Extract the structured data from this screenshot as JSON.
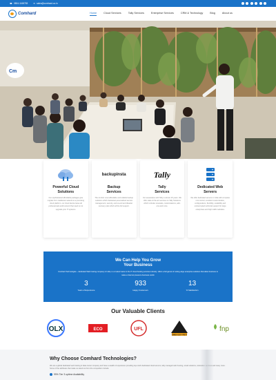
{
  "topbar": {
    "phone": "0804-1168783",
    "email": "sales@comhard.co.in",
    "socials": [
      "facebook-icon",
      "twitter-icon",
      "linkedin-icon",
      "instagram-icon",
      "youtube-icon",
      "whatsapp-icon"
    ]
  },
  "brand": {
    "logo_text": "Comhard"
  },
  "nav": {
    "items": [
      "Home",
      "Cloud Services",
      "Tally Services",
      "Enterprise Services",
      "CRM & Technology",
      "Blog",
      "About us"
    ],
    "active": "Home"
  },
  "cards": [
    {
      "logo": "cloud-icon",
      "title": "Powerful Cloud\nSolutions",
      "desc": "Our sophisticated affordable packages give migrate from traditional network to a promising cloud platform. our cloud device leave all professionals world around that need to not upgrade your IT systems."
    },
    {
      "logo": "backupinsta",
      "title": "Backup\nServices",
      "desc": "The comfort most affordable and reliable backup solutions which dedicated personalized service management, security, end-to-end and disaster recovery plan which all the full support."
    },
    {
      "logo": "Tally",
      "title": "Tally\nServices",
      "desc": "Our association with Tally is almost 15 years. We offer state-of-the-art services on Tally Solutions which includes renewals, customisations, add-ons and more."
    },
    {
      "logo": "server-icon",
      "title": "Dedicated Web\nServers",
      "desc": "We offer dedicated servers in India with complete root control, excellent customization, configurations, flexibility, scalability and uninterrupted technical support for large enterprises and high traffic websites."
    }
  ],
  "stats": {
    "title_line1": "We Can Help You Grow",
    "title_line2": "Your Business",
    "desc": "Comhard Technologies – dedicated Web hosting company in India, is a trusted name in the IT cloud hosting services industry. offers a full gamut of cutting edge enterprise solutions that allow business to make a Internet presence business world.",
    "items": [
      {
        "value": "3",
        "label": "Years of Experience"
      },
      {
        "value": "933",
        "label": "Happy Customers"
      },
      {
        "value": "13",
        "label": "% Satisfaction"
      }
    ]
  },
  "clients": {
    "title": "Our Valuable Clients",
    "logos": [
      "OLX",
      "ECO",
      "UFL",
      "EMBASSY REIT",
      "fnp"
    ]
  },
  "why": {
    "title": "Why Choose Comhard Technologies?",
    "desc": "We are a global dedicated web hosting & data center company and have a wealth of experience providing top-notch dedicated cloud servers, tally managed web hosting, email solutions, colocation services and many more. Some of the attributes that make us stand out from the competition include:",
    "item": "99% Tier 3 uptime Availability"
  },
  "colors": {
    "brand_blue": "#1a73c8",
    "logo_dark": "#1a4fa0"
  }
}
